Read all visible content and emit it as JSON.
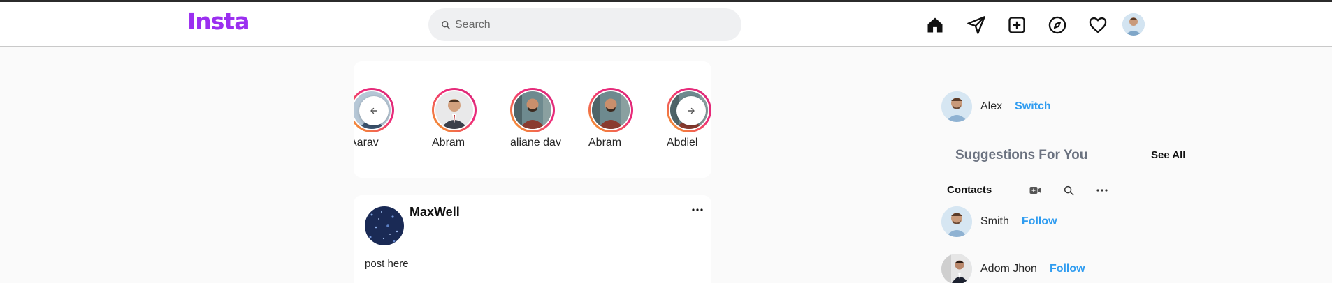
{
  "app": {
    "logo": "Insta"
  },
  "search": {
    "placeholder": "Search",
    "value": ""
  },
  "nav": {
    "icons": [
      "home-icon",
      "send-icon",
      "add-post-icon",
      "explore-icon",
      "heart-icon"
    ]
  },
  "stories": [
    {
      "name": "Aarav"
    },
    {
      "name": "Abram"
    },
    {
      "name": "aliane dav"
    },
    {
      "name": "Abram"
    },
    {
      "name": "Abdiel"
    }
  ],
  "post": {
    "username": "MaxWell",
    "text": "post here"
  },
  "sidebar": {
    "current_user": {
      "name": "Alex",
      "action": "Switch"
    },
    "suggestions_title": "Suggestions For You",
    "see_all": "See All",
    "contacts_label": "Contacts",
    "suggestions": [
      {
        "name": "Smith",
        "action": "Follow"
      },
      {
        "name": "Adom Jhon",
        "action": "Follow"
      }
    ]
  },
  "colors": {
    "brand": "#9b2ff0",
    "link": "#2f9cf0",
    "story_ring_start": "#f5a623",
    "story_ring_end": "#d62976"
  }
}
